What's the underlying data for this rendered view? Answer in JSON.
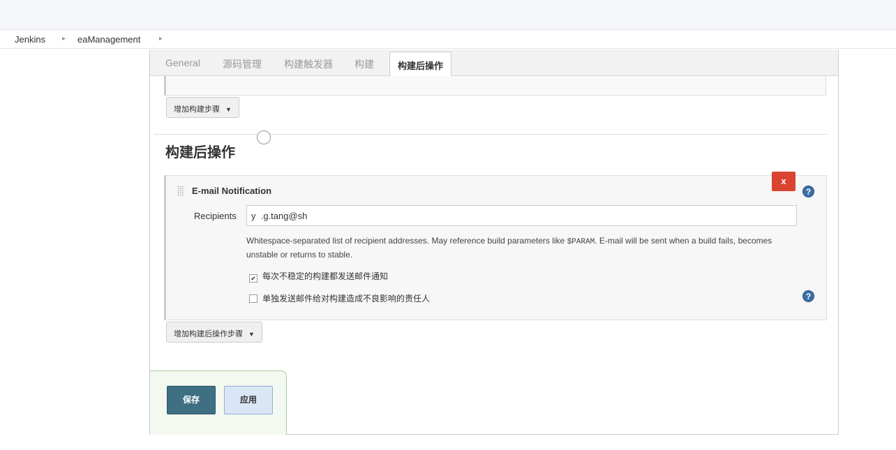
{
  "breadcrumb": {
    "items": [
      "Jenkins",
      "eaManagement"
    ],
    "separator": "▸"
  },
  "tabs": [
    "General",
    "源码管理",
    "构建触发器",
    "构建",
    "构建后操作"
  ],
  "active_tab_index": 4,
  "build": {
    "add_step_label": "增加构建步骤"
  },
  "post_build": {
    "section_title": "构建后操作",
    "email": {
      "title": "E-mail Notification",
      "delete_label": "x",
      "recipients_label": "Recipients",
      "recipients_value": "y  .g.tang@sh",
      "description_pre": "Whitespace-separated list of recipient addresses. May reference build parameters like ",
      "description_code": "$PARAM",
      "description_post": ". E-mail will be sent when a build fails, becomes unstable or returns to stable.",
      "checkbox_unstable": {
        "label": "每次不稳定的构建都发送邮件通知",
        "checked": true
      },
      "checkbox_individual": {
        "label": "单独发送邮件给对构建造成不良影响的责任人",
        "checked": false
      },
      "help_label": "?"
    },
    "add_step_label": "增加构建后操作步骤"
  },
  "actions": {
    "save_label": "保存",
    "apply_label": "应用"
  },
  "colors": {
    "delete": "#d9432f",
    "save": "#3e6f82",
    "apply": "#d9e6f5",
    "help": "#3b6ea5"
  }
}
